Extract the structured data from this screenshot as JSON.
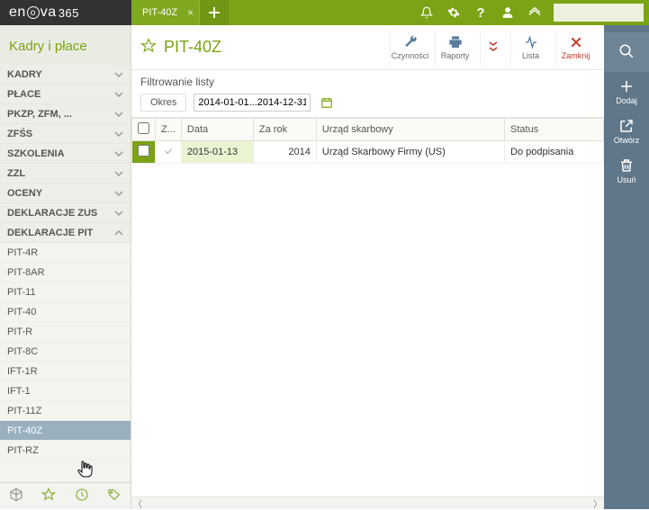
{
  "topbar": {
    "logo_html": "enova365",
    "tab_label": "PIT-40Z",
    "search_placeholder": ""
  },
  "sidebar": {
    "module_title": "Kadry i płace",
    "cats": [
      {
        "label": "KADRY",
        "expanded": false
      },
      {
        "label": "PŁACE",
        "expanded": false
      },
      {
        "label": "PKZP, ZFM, ...",
        "expanded": false
      },
      {
        "label": "ZFŚS",
        "expanded": false
      },
      {
        "label": "SZKOLENIA",
        "expanded": false
      },
      {
        "label": "ZZL",
        "expanded": false
      },
      {
        "label": "OCENY",
        "expanded": false
      },
      {
        "label": "DEKLARACJE ZUS",
        "expanded": false
      },
      {
        "label": "DEKLARACJE PIT",
        "expanded": true
      }
    ],
    "subs": [
      "PIT-4R",
      "PIT-8AR",
      "PIT-11",
      "PIT-40",
      "PIT-R",
      "PIT-8C",
      "IFT-1R",
      "IFT-1",
      "PIT-11Z",
      "PIT-40Z",
      "PIT-RZ"
    ],
    "selected_sub": "PIT-40Z"
  },
  "toolbar": {
    "page_title": "PIT-40Z",
    "btns": {
      "czynnosci": "Czynności",
      "raporty": "Raporty",
      "lista": "Lista",
      "zamknij": "Zamknij"
    }
  },
  "filter": {
    "title": "Filtrowanie listy",
    "period_label": "Okres",
    "period_value": "2014-01-01...2014-12-31"
  },
  "grid": {
    "headers": {
      "z": "Z...",
      "data": "Data",
      "zarok": "Za rok",
      "urzad": "Urząd skarbowy",
      "status": "Status"
    },
    "rows": [
      {
        "data": "2015-01-13",
        "zarok": "2014",
        "urzad": "Urząd Skarbowy Firmy (US)",
        "status": "Do podpisania"
      }
    ]
  },
  "rail": {
    "dodaj": "Dodaj",
    "otworz": "Otwórz",
    "usun": "Usuń"
  }
}
